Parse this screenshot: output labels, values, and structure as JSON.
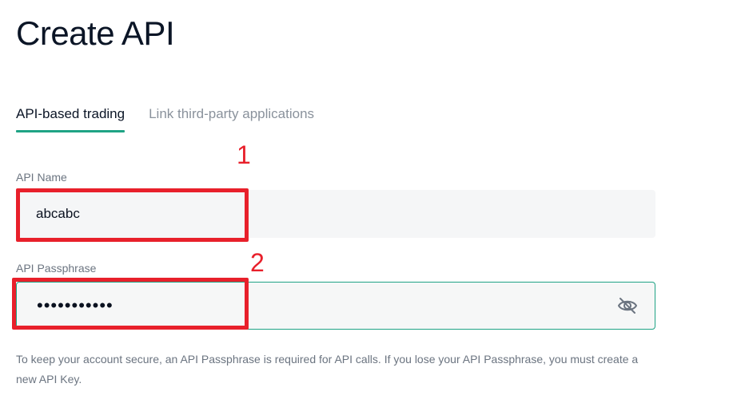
{
  "page": {
    "title": "Create API"
  },
  "tabs": [
    {
      "label": "API-based trading",
      "active": true
    },
    {
      "label": "Link third-party applications",
      "active": false
    }
  ],
  "form": {
    "api_name": {
      "label": "API Name",
      "value": "abcabc"
    },
    "api_passphrase": {
      "label": "API Passphrase",
      "value": "•••••••••••",
      "visibility_icon": "eye-slash-icon"
    },
    "helper_text": "To keep your account secure, an API Passphrase is required for API calls. If you lose your API Passphrase, you must create a new API Key."
  },
  "annotations": [
    {
      "number": "1",
      "color": "#e8202b"
    },
    {
      "number": "2",
      "color": "#e8202b"
    }
  ],
  "colors": {
    "accent": "#1fa385",
    "annotation": "#e8202b",
    "input_bg": "#f5f6f7",
    "muted_text": "#6b7480"
  }
}
